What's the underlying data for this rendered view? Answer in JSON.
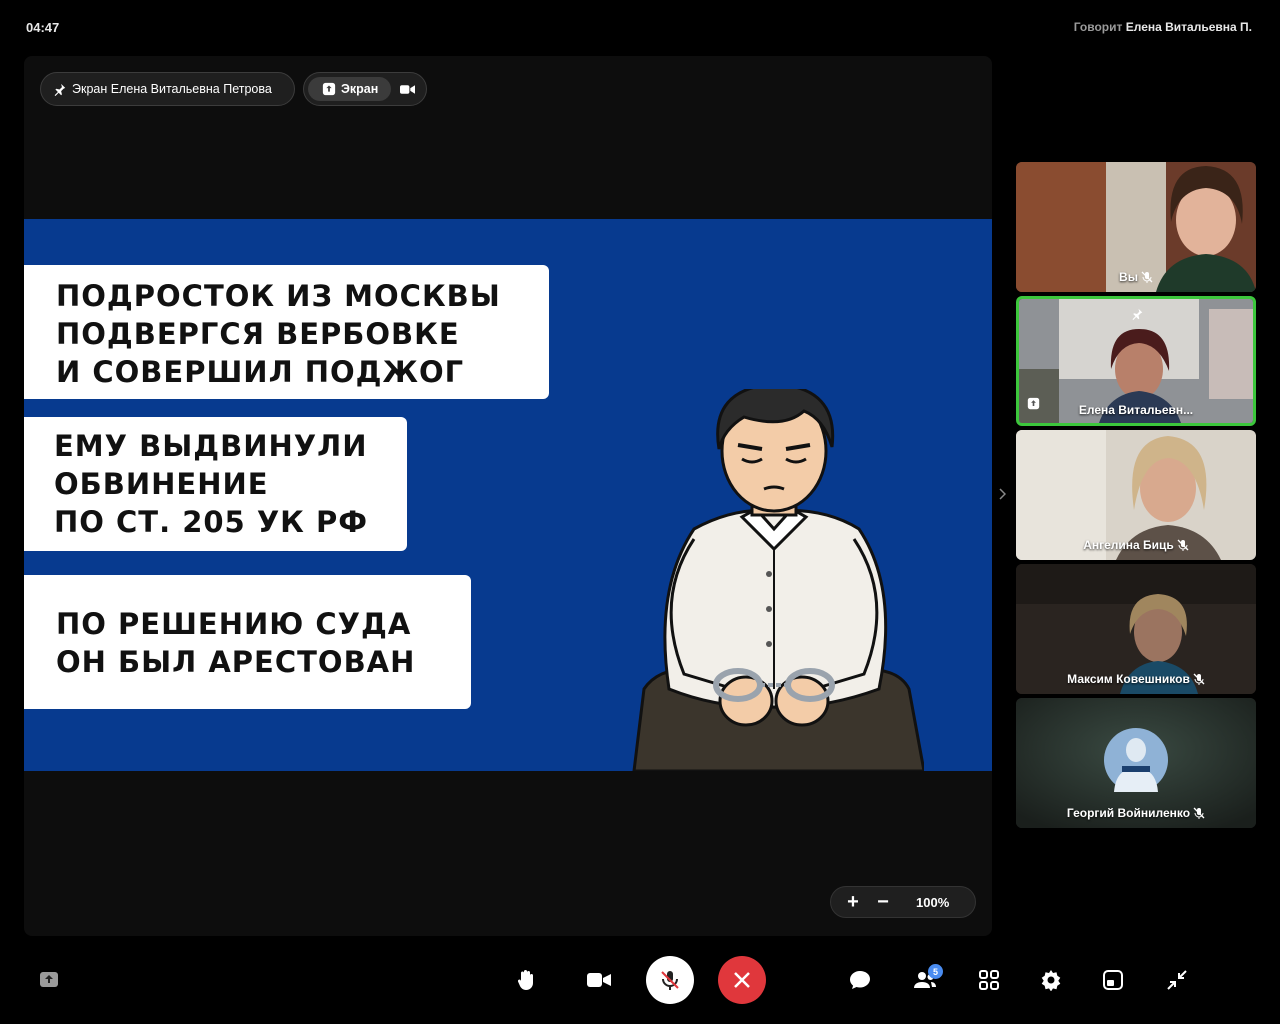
{
  "status": {
    "time": "04:47",
    "speaking_prefix": "Говорит",
    "speaking_name": "Елена Витальевна П."
  },
  "stage": {
    "pin_label": "Экран Елена Витальевна Петрова",
    "source_label": "Экран",
    "zoom_plus": "+",
    "zoom_minus": "−",
    "zoom_value": "100%"
  },
  "slide": {
    "card1": [
      "Подросток из Москвы",
      "подвергся вербовке",
      "и совершил поджог"
    ],
    "card2": [
      "Ему выдвинули",
      "обвинение",
      "по ст. 205 УК РФ"
    ],
    "card3": [
      "По решению суда",
      "он был арестован"
    ]
  },
  "participants": [
    {
      "name": "Вы",
      "muted": true
    },
    {
      "name": "Елена Витальевн...",
      "muted": false,
      "active": true,
      "pinned": true,
      "sharing": true
    },
    {
      "name": "Ангелина Биць",
      "muted": true
    },
    {
      "name": "Максим Ковешников",
      "muted": true
    },
    {
      "name": "Георгий Войниленко",
      "muted": true
    }
  ],
  "toolbar": {
    "participants_count": "5"
  },
  "colors": {
    "slide_bg": "#073a8f",
    "active_border": "#3cc73c",
    "end_call": "#e0373c",
    "badge": "#4a8cf0"
  }
}
